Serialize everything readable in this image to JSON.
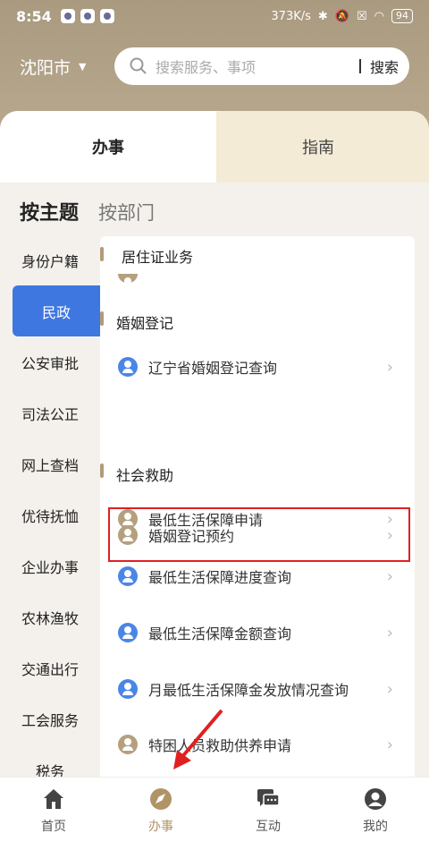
{
  "status_bar": {
    "time": "8:54",
    "speed": "373K/s",
    "battery": "94"
  },
  "header": {
    "city": "沈阳市",
    "search_placeholder": "搜索服务、事项",
    "search_button": "搜索"
  },
  "tabs": {
    "active": "办事",
    "inactive": "指南"
  },
  "modes": {
    "active": "按主题",
    "inactive": "按部门"
  },
  "left_nav": [
    "身份户籍",
    "民政",
    "公安审批",
    "司法公正",
    "网上查档",
    "优待抚恤",
    "企业办事",
    "农林渔牧",
    "交通出行",
    "工会服务",
    "税务"
  ],
  "sections": {
    "s1": "居住证业务",
    "s2": "婚姻登记",
    "s3": "社会救助"
  },
  "items": {
    "i1": "辽宁省婚姻登记查询",
    "i2": "婚姻登记预约",
    "i3": "最低生活保障申请",
    "i4": "最低生活保障进度查询",
    "i5": "最低生活保障金额查询",
    "i6": "月最低生活保障金发放情况查询",
    "i7": "特困人员救助供养申请"
  },
  "bottom_nav": [
    "首页",
    "办事",
    "互动",
    "我的"
  ],
  "colors": {
    "accent": "#b09468",
    "active_nav": "#3f77e0",
    "highlight": "#e02020"
  }
}
